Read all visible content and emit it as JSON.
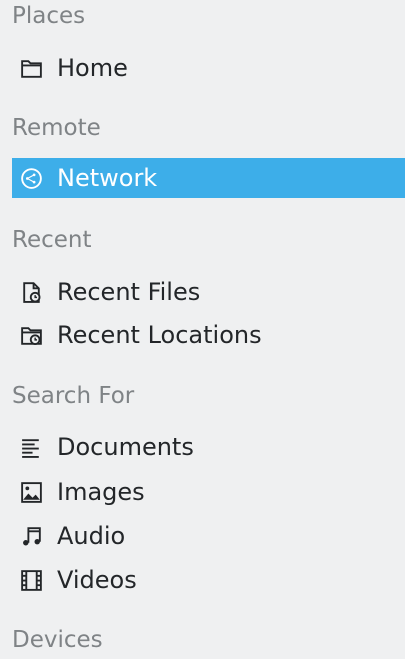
{
  "sections": {
    "places": {
      "header": "Places",
      "items": [
        {
          "label": "Home",
          "icon": "folder-home-icon"
        }
      ]
    },
    "remote": {
      "header": "Remote",
      "items": [
        {
          "label": "Network",
          "icon": "network-icon",
          "selected": true
        }
      ]
    },
    "recent": {
      "header": "Recent",
      "items": [
        {
          "label": "Recent Files",
          "icon": "recent-files-icon"
        },
        {
          "label": "Recent Locations",
          "icon": "recent-locations-icon"
        }
      ]
    },
    "search_for": {
      "header": "Search For",
      "items": [
        {
          "label": "Documents",
          "icon": "documents-icon"
        },
        {
          "label": "Images",
          "icon": "images-icon"
        },
        {
          "label": "Audio",
          "icon": "audio-icon"
        },
        {
          "label": "Videos",
          "icon": "videos-icon"
        }
      ]
    },
    "devices": {
      "header": "Devices"
    }
  },
  "colors": {
    "background": "#eff0f1",
    "selection": "#3daee9",
    "header_text": "#7f8386",
    "item_text": "#232629"
  }
}
